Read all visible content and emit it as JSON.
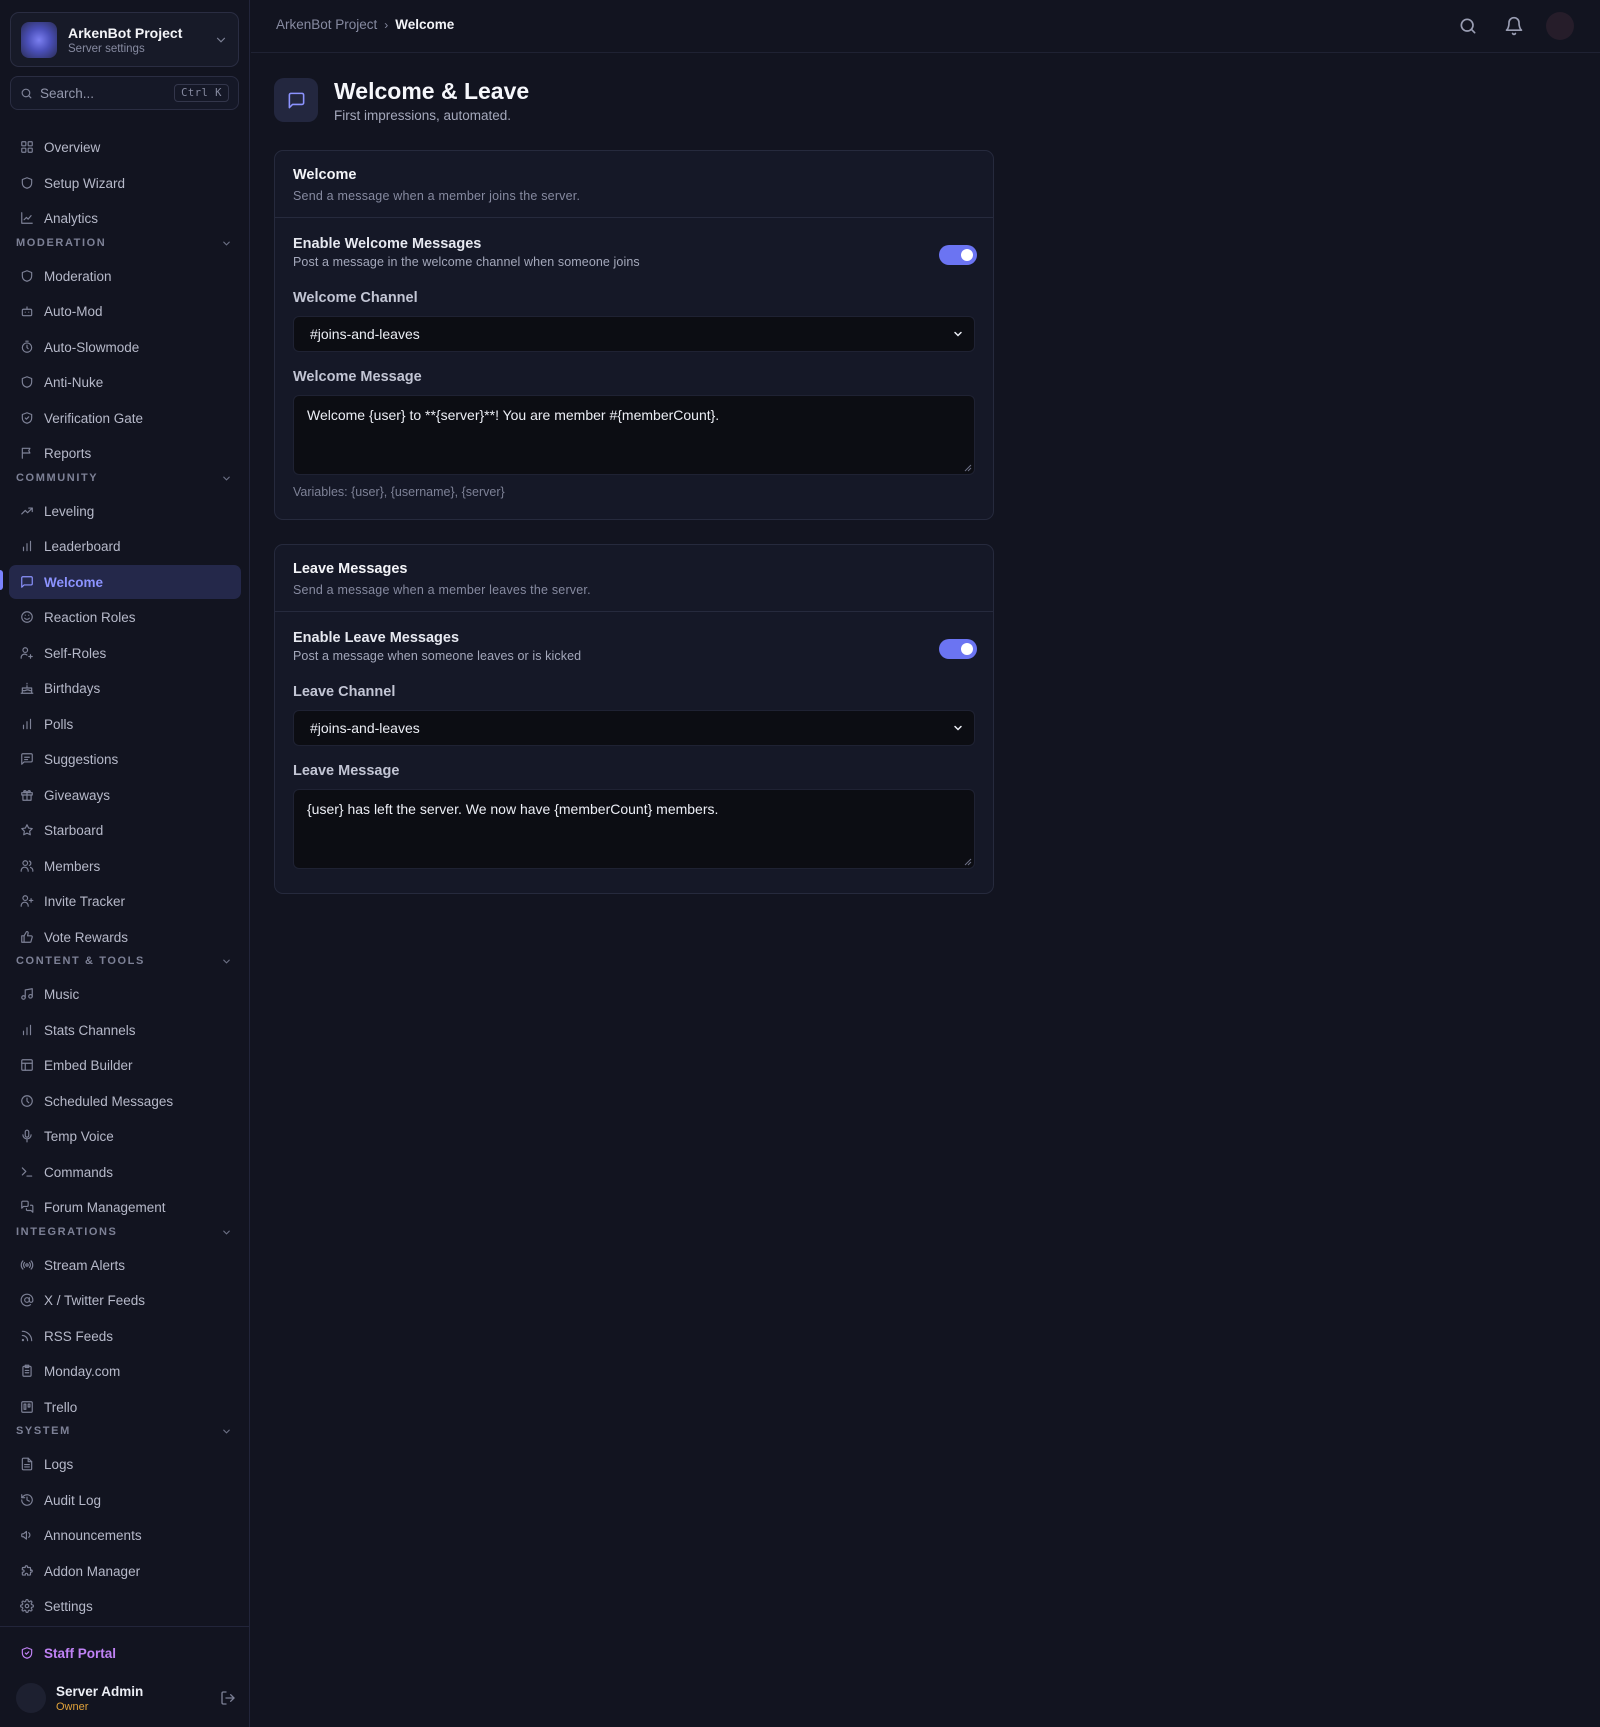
{
  "server": {
    "name": "ArkenBot Project",
    "subtitle": "Server settings"
  },
  "search": {
    "placeholder": "Search...",
    "shortcut": "Ctrl K"
  },
  "nav": {
    "general": [
      {
        "label": "Overview",
        "icon": "grid-icon"
      },
      {
        "label": "Setup Wizard",
        "icon": "shield-icon"
      },
      {
        "label": "Analytics",
        "icon": "chart-line-icon"
      }
    ],
    "sections": [
      {
        "title": "MODERATION",
        "items": [
          {
            "label": "Moderation",
            "icon": "shield-icon"
          },
          {
            "label": "Auto-Mod",
            "icon": "robot-icon"
          },
          {
            "label": "Auto-Slowmode",
            "icon": "timer-icon"
          },
          {
            "label": "Anti-Nuke",
            "icon": "shield-icon"
          },
          {
            "label": "Verification Gate",
            "icon": "shield-check-icon"
          },
          {
            "label": "Reports",
            "icon": "flag-icon"
          }
        ]
      },
      {
        "title": "COMMUNITY",
        "items": [
          {
            "label": "Leveling",
            "icon": "trending-up-icon"
          },
          {
            "label": "Leaderboard",
            "icon": "bar-chart-icon"
          },
          {
            "label": "Welcome",
            "icon": "message-icon",
            "active": true
          },
          {
            "label": "Reaction Roles",
            "icon": "smile-icon"
          },
          {
            "label": "Self-Roles",
            "icon": "user-cog-icon"
          },
          {
            "label": "Birthdays",
            "icon": "cake-icon"
          },
          {
            "label": "Polls",
            "icon": "bar-chart-icon"
          },
          {
            "label": "Suggestions",
            "icon": "message-square-icon"
          },
          {
            "label": "Giveaways",
            "icon": "gift-icon"
          },
          {
            "label": "Starboard",
            "icon": "star-icon"
          },
          {
            "label": "Members",
            "icon": "users-icon"
          },
          {
            "label": "Invite Tracker",
            "icon": "user-plus-icon"
          },
          {
            "label": "Vote Rewards",
            "icon": "thumbs-up-icon"
          }
        ]
      },
      {
        "title": "CONTENT & TOOLS",
        "items": [
          {
            "label": "Music",
            "icon": "music-icon"
          },
          {
            "label": "Stats Channels",
            "icon": "bar-chart-icon"
          },
          {
            "label": "Embed Builder",
            "icon": "layout-icon"
          },
          {
            "label": "Scheduled Messages",
            "icon": "clock-icon"
          },
          {
            "label": "Temp Voice",
            "icon": "mic-icon"
          },
          {
            "label": "Commands",
            "icon": "terminal-icon"
          },
          {
            "label": "Forum Management",
            "icon": "messages-icon"
          }
        ]
      },
      {
        "title": "INTEGRATIONS",
        "items": [
          {
            "label": "Stream Alerts",
            "icon": "radio-icon"
          },
          {
            "label": "X / Twitter Feeds",
            "icon": "at-sign-icon"
          },
          {
            "label": "RSS Feeds",
            "icon": "rss-icon"
          },
          {
            "label": "Monday.com",
            "icon": "clipboard-icon"
          },
          {
            "label": "Trello",
            "icon": "trello-icon"
          }
        ]
      },
      {
        "title": "SYSTEM",
        "items": [
          {
            "label": "Logs",
            "icon": "file-text-icon"
          },
          {
            "label": "Audit Log",
            "icon": "history-icon"
          },
          {
            "label": "Announcements",
            "icon": "megaphone-icon"
          },
          {
            "label": "Addon Manager",
            "icon": "puzzle-icon"
          },
          {
            "label": "Settings",
            "icon": "gear-icon"
          }
        ]
      }
    ],
    "staff_portal": "Staff Portal"
  },
  "user": {
    "name": "Server Admin",
    "role": "Owner"
  },
  "breadcrumb": {
    "root": "ArkenBot Project",
    "separator": "›",
    "current": "Welcome"
  },
  "page": {
    "title": "Welcome & Leave",
    "subtitle": "First impressions, automated."
  },
  "welcome_card": {
    "title": "Welcome",
    "description": "Send a message when a member joins the server.",
    "toggle_title": "Enable Welcome Messages",
    "toggle_desc": "Post a message in the welcome channel when someone joins",
    "toggle_on": true,
    "channel_label": "Welcome Channel",
    "channel_value": "#joins-and-leaves",
    "message_label": "Welcome Message",
    "message_value": "Welcome {user} to **{server}**! You are member #{memberCount}.",
    "variables_hint": "Variables: {user}, {username}, {server}"
  },
  "leave_card": {
    "title": "Leave Messages",
    "description": "Send a message when a member leaves the server.",
    "toggle_title": "Enable Leave Messages",
    "toggle_desc": "Post a message when someone leaves or is kicked",
    "toggle_on": true,
    "channel_label": "Leave Channel",
    "channel_value": "#joins-and-leaves",
    "message_label": "Leave Message",
    "message_value": "{user} has left the server. We now have {memberCount} members."
  },
  "colors": {
    "accent": "#6b74f2",
    "active_text": "#8c93ff",
    "staff": "#c082f5",
    "owner": "#e0a23a",
    "background": "#121420"
  }
}
